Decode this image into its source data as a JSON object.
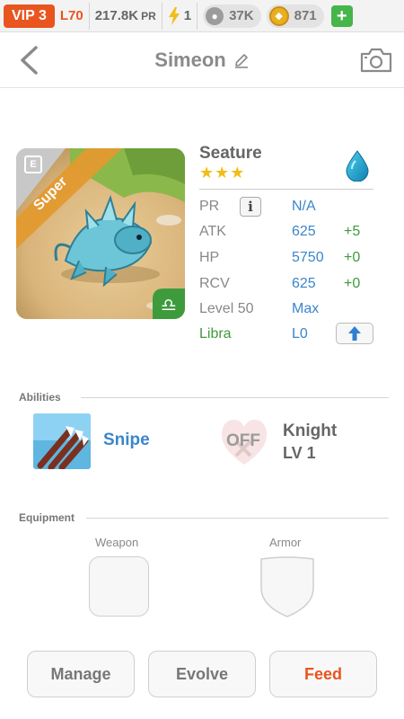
{
  "status_bar": {
    "vip": "VIP 3",
    "level": "L70",
    "power": "217.8K",
    "power_unit": "PR",
    "energy": "1",
    "paws": "37K",
    "coins": "871",
    "add_label": "+"
  },
  "header": {
    "title": "Simeon"
  },
  "creature": {
    "name": "Seature",
    "stars": "★★★",
    "rarity_ribbon": "Super",
    "element": "water-drop-icon",
    "zodiac": "libra-icon",
    "stats": [
      {
        "label": "PR",
        "value": "N/A",
        "bonus": ""
      },
      {
        "label": "ATK",
        "value": "625",
        "bonus": "+5"
      },
      {
        "label": "HP",
        "value": "5750",
        "bonus": "+0"
      },
      {
        "label": "RCV",
        "value": "625",
        "bonus": "+0"
      },
      {
        "label": "Level 50",
        "value": "Max",
        "bonus": ""
      },
      {
        "label": "Libra",
        "value": "L0",
        "bonus": ""
      }
    ],
    "info_label": "i"
  },
  "abilities": {
    "title": "Abilities",
    "primary": {
      "name": "Snipe"
    },
    "secondary": {
      "status": "OFF",
      "name": "Knight",
      "level": "LV 1"
    }
  },
  "equipment": {
    "title": "Equipment",
    "weapon_label": "Weapon",
    "armor_label": "Armor"
  },
  "actions": {
    "manage": "Manage",
    "evolve": "Evolve",
    "feed": "Feed"
  },
  "colors": {
    "accent_orange": "#e8551f",
    "value_blue": "#3a86cc",
    "bonus_green": "#3f9a3a",
    "star_gold": "#f2bd18"
  }
}
